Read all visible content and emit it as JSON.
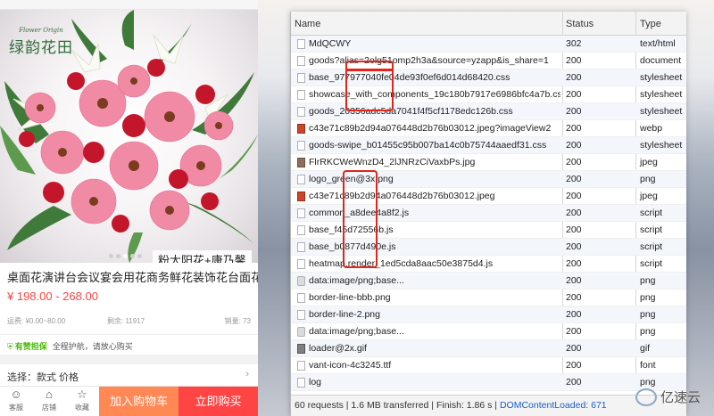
{
  "product": {
    "brand_logo_cn": "绿韵花田",
    "brand_logo_en": "Flower Origin",
    "image_caption": "粉太阳花+康乃馨",
    "title": "桌面花演讲台会议宴会用花商务鲜花装饰花台面花",
    "price": "¥ 198.00 - 268.00",
    "shipping": "运费: ¥0.00~80.00",
    "stock": "剩余: 11917",
    "sales": "销量: 73",
    "guarantee_badge": "有赞担保",
    "guarantee_text": "全程护航，请放心购买",
    "select_label": "选择：",
    "select_options": "款式  价格",
    "slide_dots": 5,
    "slide_active": 2
  },
  "bottom_bar": {
    "customer_service": "客服",
    "shop": "店铺",
    "favorite": "收藏",
    "add_to_cart": "加入购物车",
    "buy_now": "立即购买"
  },
  "network": {
    "columns": {
      "name": "Name",
      "status": "Status",
      "type": "Type"
    },
    "rows": [
      {
        "name": "MdQCWY",
        "status": "302",
        "type": "text/html",
        "icon": "file-icon"
      },
      {
        "name": "goods?alias=2olg51omp2h3a&source=yzapp&is_share=1",
        "status": "200",
        "type": "document",
        "icon": "file-icon"
      },
      {
        "name": "base_977977040fe04de93f0ef6d014d68420.css",
        "status": "200",
        "type": "stylesheet",
        "icon": "file-icon"
      },
      {
        "name": "showcase_with_components_19c180b7917e6986bfc4a7b.css",
        "status": "200",
        "type": "stylesheet",
        "icon": "file-icon"
      },
      {
        "name": "goods_20356adc5da7041f4f5cf1178edc126b.css",
        "status": "200",
        "type": "stylesheet",
        "icon": "file-icon"
      },
      {
        "name": "c43e71c89b2d94a076448d2b76b03012.jpeg?imageView2",
        "status": "200",
        "type": "webp",
        "icon": "image-icon"
      },
      {
        "name": "goods-swipe_b01455c95b007ba14c0b75744aaedf31.css",
        "status": "200",
        "type": "stylesheet",
        "icon": "file-icon"
      },
      {
        "name": "FlrRKCWeWnzD4_2lJNRzCiVaxbPs.jpg",
        "status": "200",
        "type": "jpeg",
        "icon": "image-icon-dark"
      },
      {
        "name": "logo_green@3x.png",
        "status": "200",
        "type": "png",
        "icon": "file-icon"
      },
      {
        "name": "c43e71c89b2d94a076448d2b76b03012.jpeg",
        "status": "200",
        "type": "jpeg",
        "icon": "image-icon"
      },
      {
        "name": "common_a8dee4a8f2.js",
        "status": "200",
        "type": "script",
        "icon": "file-icon"
      },
      {
        "name": "base_f45d72556b.js",
        "status": "200",
        "type": "script",
        "icon": "file-icon"
      },
      {
        "name": "base_b0877d490e.js",
        "status": "200",
        "type": "script",
        "icon": "file-icon"
      },
      {
        "name": "heatmap.render_1ed5cda8aac50e3875d4.js",
        "status": "200",
        "type": "script",
        "icon": "file-icon"
      },
      {
        "name": "data:image/png;base...",
        "status": "200",
        "type": "png",
        "icon": "data-icon"
      },
      {
        "name": "border-line-bbb.png",
        "status": "200",
        "type": "png",
        "icon": "file-icon"
      },
      {
        "name": "border-line-2.png",
        "status": "200",
        "type": "png",
        "icon": "file-icon"
      },
      {
        "name": "data:image/png;base...",
        "status": "200",
        "type": "png",
        "icon": "data-icon"
      },
      {
        "name": "loader@2x.gif",
        "status": "200",
        "type": "gif",
        "icon": "gif-icon"
      },
      {
        "name": "vant-icon-4c3245.ttf",
        "status": "200",
        "type": "font",
        "icon": "file-icon"
      },
      {
        "name": "log",
        "status": "200",
        "type": "png",
        "icon": "file-icon"
      }
    ],
    "footer_stats": "60 requests | 1.6 MB transferred | Finish: 1.86 s | ",
    "footer_dom": "DOMContentLoaded: 671"
  },
  "watermark": {
    "text": "亿速云"
  },
  "colors": {
    "price": "#ff4444",
    "cart_button": "#ff8855",
    "buy_button": "#ff4444",
    "annotation": "#e0261b",
    "dom_link": "#1a5fc7",
    "guarantee": "#44bb00"
  }
}
